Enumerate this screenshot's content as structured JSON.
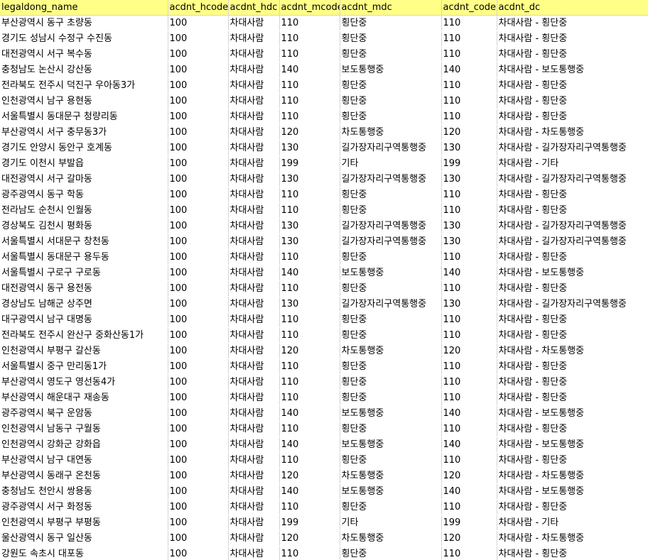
{
  "header_bg": "#ffff88",
  "columns": [
    "legaldong_name",
    "acdnt_hcode",
    "acdnt_hdc",
    "acdnt_mcode",
    "acdnt_mdc",
    "acdnt_code",
    "acdnt_dc"
  ],
  "rows": [
    [
      "부산광역시 동구 초량동",
      "100",
      "차대사람",
      "110",
      "횡단중",
      "110",
      "차대사람 - 횡단중"
    ],
    [
      "경기도 성남시 수정구 수진동",
      "100",
      "차대사람",
      "110",
      "횡단중",
      "110",
      "차대사람 - 횡단중"
    ],
    [
      "대전광역시 서구 복수동",
      "100",
      "차대사람",
      "110",
      "횡단중",
      "110",
      "차대사람 - 횡단중"
    ],
    [
      "충청남도 논산시 강산동",
      "100",
      "차대사람",
      "140",
      "보도통행중",
      "140",
      "차대사람 - 보도통행중"
    ],
    [
      "전라북도 전주시 덕진구 우아동3가",
      "100",
      "차대사람",
      "110",
      "횡단중",
      "110",
      "차대사람 - 횡단중"
    ],
    [
      "인천광역시 남구 용현동",
      "100",
      "차대사람",
      "110",
      "횡단중",
      "110",
      "차대사람 - 횡단중"
    ],
    [
      "서울특별시 동대문구 청량리동",
      "100",
      "차대사람",
      "110",
      "횡단중",
      "110",
      "차대사람 - 횡단중"
    ],
    [
      "부산광역시 서구 충무동3가",
      "100",
      "차대사람",
      "120",
      "차도통행중",
      "120",
      "차대사람 - 차도통행중"
    ],
    [
      "경기도 안양시 동안구 호계동",
      "100",
      "차대사람",
      "130",
      "길가장자리구역통행중",
      "130",
      "차대사람 - 길가장자리구역통행중"
    ],
    [
      "경기도 이천시 부발읍",
      "100",
      "차대사람",
      "199",
      "기타",
      "199",
      "차대사람 - 기타"
    ],
    [
      "대전광역시 서구 갈마동",
      "100",
      "차대사람",
      "130",
      "길가장자리구역통행중",
      "130",
      "차대사람 - 길가장자리구역통행중"
    ],
    [
      "광주광역시 동구 학동",
      "100",
      "차대사람",
      "110",
      "횡단중",
      "110",
      "차대사람 - 횡단중"
    ],
    [
      "전라남도 순천시 인월동",
      "100",
      "차대사람",
      "110",
      "횡단중",
      "110",
      "차대사람 - 횡단중"
    ],
    [
      "경상북도 김천시 평화동",
      "100",
      "차대사람",
      "130",
      "길가장자리구역통행중",
      "130",
      "차대사람 - 길가장자리구역통행중"
    ],
    [
      "서울특별시 서대문구 창천동",
      "100",
      "차대사람",
      "130",
      "길가장자리구역통행중",
      "130",
      "차대사람 - 길가장자리구역통행중"
    ],
    [
      "서울특별시 동대문구 용두동",
      "100",
      "차대사람",
      "110",
      "횡단중",
      "110",
      "차대사람 - 횡단중"
    ],
    [
      "서울특별시 구로구 구로동",
      "100",
      "차대사람",
      "140",
      "보도통행중",
      "140",
      "차대사람 - 보도통행중"
    ],
    [
      "대전광역시 동구 용전동",
      "100",
      "차대사람",
      "110",
      "횡단중",
      "110",
      "차대사람 - 횡단중"
    ],
    [
      "경상남도 남해군 상주면",
      "100",
      "차대사람",
      "130",
      "길가장자리구역통행중",
      "130",
      "차대사람 - 길가장자리구역통행중"
    ],
    [
      "대구광역시 남구 대명동",
      "100",
      "차대사람",
      "110",
      "횡단중",
      "110",
      "차대사람 - 횡단중"
    ],
    [
      "전라북도 전주시 완산구 중화산동1가",
      "100",
      "차대사람",
      "110",
      "횡단중",
      "110",
      "차대사람 - 횡단중"
    ],
    [
      "인천광역시 부평구 갈산동",
      "100",
      "차대사람",
      "120",
      "차도통행중",
      "120",
      "차대사람 - 차도통행중"
    ],
    [
      "서울특별시 중구 만리동1가",
      "100",
      "차대사람",
      "110",
      "횡단중",
      "110",
      "차대사람 - 횡단중"
    ],
    [
      "부산광역시 영도구 영선동4가",
      "100",
      "차대사람",
      "110",
      "횡단중",
      "110",
      "차대사람 - 횡단중"
    ],
    [
      "부산광역시 해운대구 재송동",
      "100",
      "차대사람",
      "110",
      "횡단중",
      "110",
      "차대사람 - 횡단중"
    ],
    [
      "광주광역시 북구 운암동",
      "100",
      "차대사람",
      "140",
      "보도통행중",
      "140",
      "차대사람 - 보도통행중"
    ],
    [
      "인천광역시 남동구 구월동",
      "100",
      "차대사람",
      "110",
      "횡단중",
      "110",
      "차대사람 - 횡단중"
    ],
    [
      "인천광역시 강화군 강화읍",
      "100",
      "차대사람",
      "140",
      "보도통행중",
      "140",
      "차대사람 - 보도통행중"
    ],
    [
      "부산광역시 남구 대연동",
      "100",
      "차대사람",
      "110",
      "횡단중",
      "110",
      "차대사람 - 횡단중"
    ],
    [
      "부산광역시 동래구 온천동",
      "100",
      "차대사람",
      "120",
      "차도통행중",
      "120",
      "차대사람 - 차도통행중"
    ],
    [
      "충청남도 천안시 쌍용동",
      "100",
      "차대사람",
      "140",
      "보도통행중",
      "140",
      "차대사람 - 보도통행중"
    ],
    [
      "광주광역시 서구 화정동",
      "100",
      "차대사람",
      "110",
      "횡단중",
      "110",
      "차대사람 - 횡단중"
    ],
    [
      "인천광역시 부평구 부평동",
      "100",
      "차대사람",
      "199",
      "기타",
      "199",
      "차대사람 - 기타"
    ],
    [
      "울산광역시 동구 일산동",
      "100",
      "차대사람",
      "120",
      "차도통행중",
      "120",
      "차대사람 - 차도통행중"
    ],
    [
      "강원도 속초시 대포동",
      "100",
      "차대사람",
      "110",
      "횡단중",
      "110",
      "차대사람 - 횡단중"
    ]
  ]
}
